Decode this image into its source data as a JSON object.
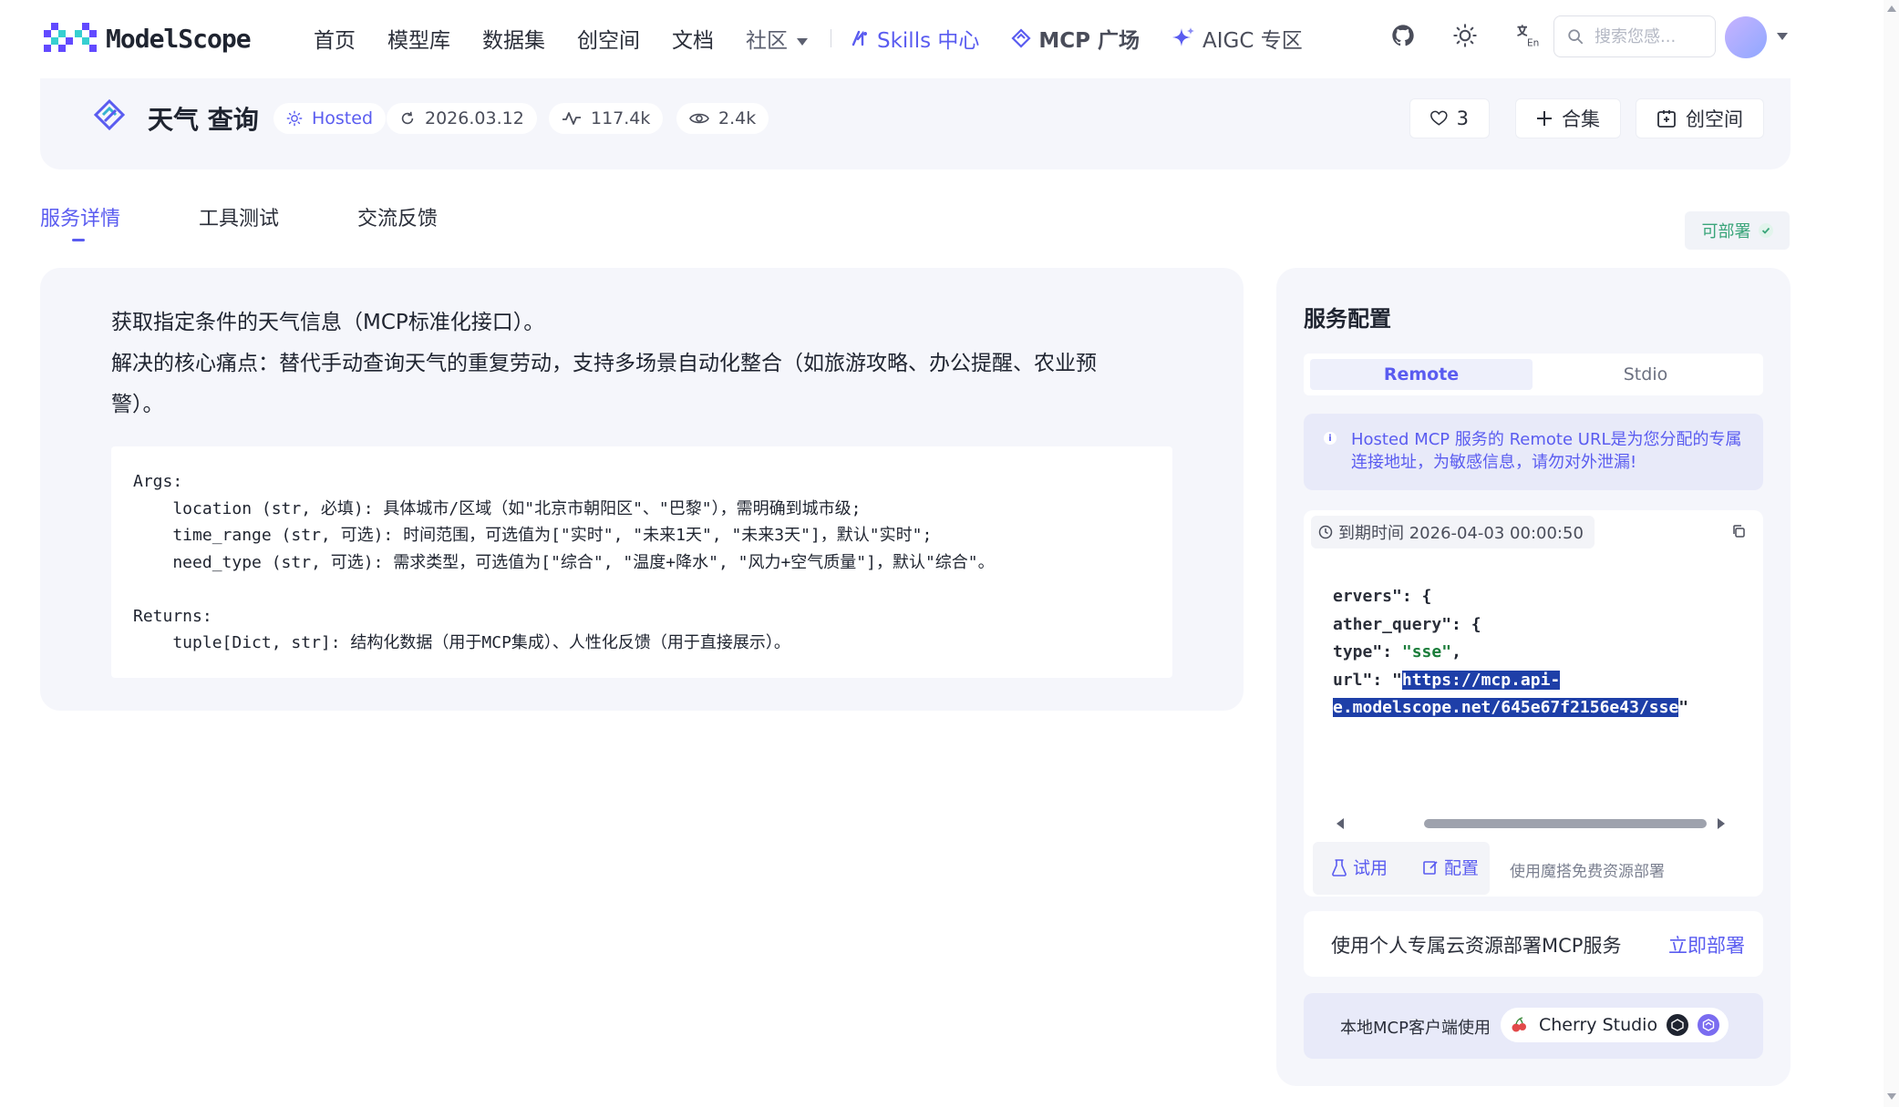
{
  "brand": {
    "name": "ModelScope"
  },
  "nav": {
    "links": [
      "首页",
      "模型库",
      "数据集",
      "创空间",
      "文档"
    ],
    "community": "社区",
    "skills": "Skills 中心",
    "mcp": "MCP 广场",
    "aigc": "AIGC 专区",
    "search_placeholder": "搜索您感..."
  },
  "header": {
    "title": "天气 查询",
    "hosted": "Hosted",
    "date": "2026.03.12",
    "calls": "117.4k",
    "views": "2.4k",
    "likes": "3",
    "collection_label": "合集",
    "space_label": "创空间"
  },
  "tabs": [
    "服务详情",
    "工具测试",
    "交流反馈"
  ],
  "deploy_badge": "可部署",
  "description": {
    "line1": "获取指定条件的天气信息（MCP标准化接口）。",
    "line2": "解决的核心痛点：替代手动查询天气的重复劳动，支持多场景自动化整合（如旅游攻略、办公提醒、农业预",
    "line3": "警）。",
    "code": "Args:\n    location (str, 必填): 具体城市/区域（如\"北京市朝阳区\"、\"巴黎\"），需明确到城市级;\n    time_range (str, 可选): 时间范围，可选值为[\"实时\", \"未来1天\", \"未来3天\"]，默认\"实时\";\n    need_type (str, 可选): 需求类型，可选值为[\"综合\", \"温度+降水\", \"风力+空气质量\"]，默认\"综合\"。\n\nReturns:\n    tuple[Dict, str]: 结构化数据（用于MCP集成）、人性化反馈（用于直接展示）。"
  },
  "config": {
    "title": "服务配置",
    "tab_remote": "Remote",
    "tab_stdio": "Stdio",
    "notice": "Hosted MCP 服务的 Remote URL是为您分配的专属连接地址，为敏感信息，请勿对外泄漏!",
    "expire": "到期时间 2026-04-03 00:00:50",
    "json": {
      "l1_key": "ervers",
      "l2_key": "ather_query",
      "l3_key": "type",
      "l3_val": "\"sse\"",
      "l4_key": "url",
      "url_a": "https://mcp.api-",
      "url_b": "e.modelscope.net/645e67f2156e43/sse"
    },
    "try_label": "试用",
    "config_label": "配置",
    "free_text": "使用魔搭免费资源部署",
    "cloud_text": "使用个人专属云资源部署MCP服务",
    "cloud_link": "立即部署",
    "client_text": "本地MCP客户端使用",
    "client_name": "Cherry Studio"
  },
  "colors": {
    "accent": "#5a5cf0",
    "success": "#3aa57a",
    "panel_bg": "#f5f6fb"
  },
  "icons": [
    "github-icon",
    "theme-icon",
    "translate-icon",
    "search-icon",
    "heart-icon",
    "plus-icon",
    "space-icon",
    "clock-icon",
    "copy-icon",
    "flask-icon",
    "edit-icon",
    "cherry-icon"
  ]
}
